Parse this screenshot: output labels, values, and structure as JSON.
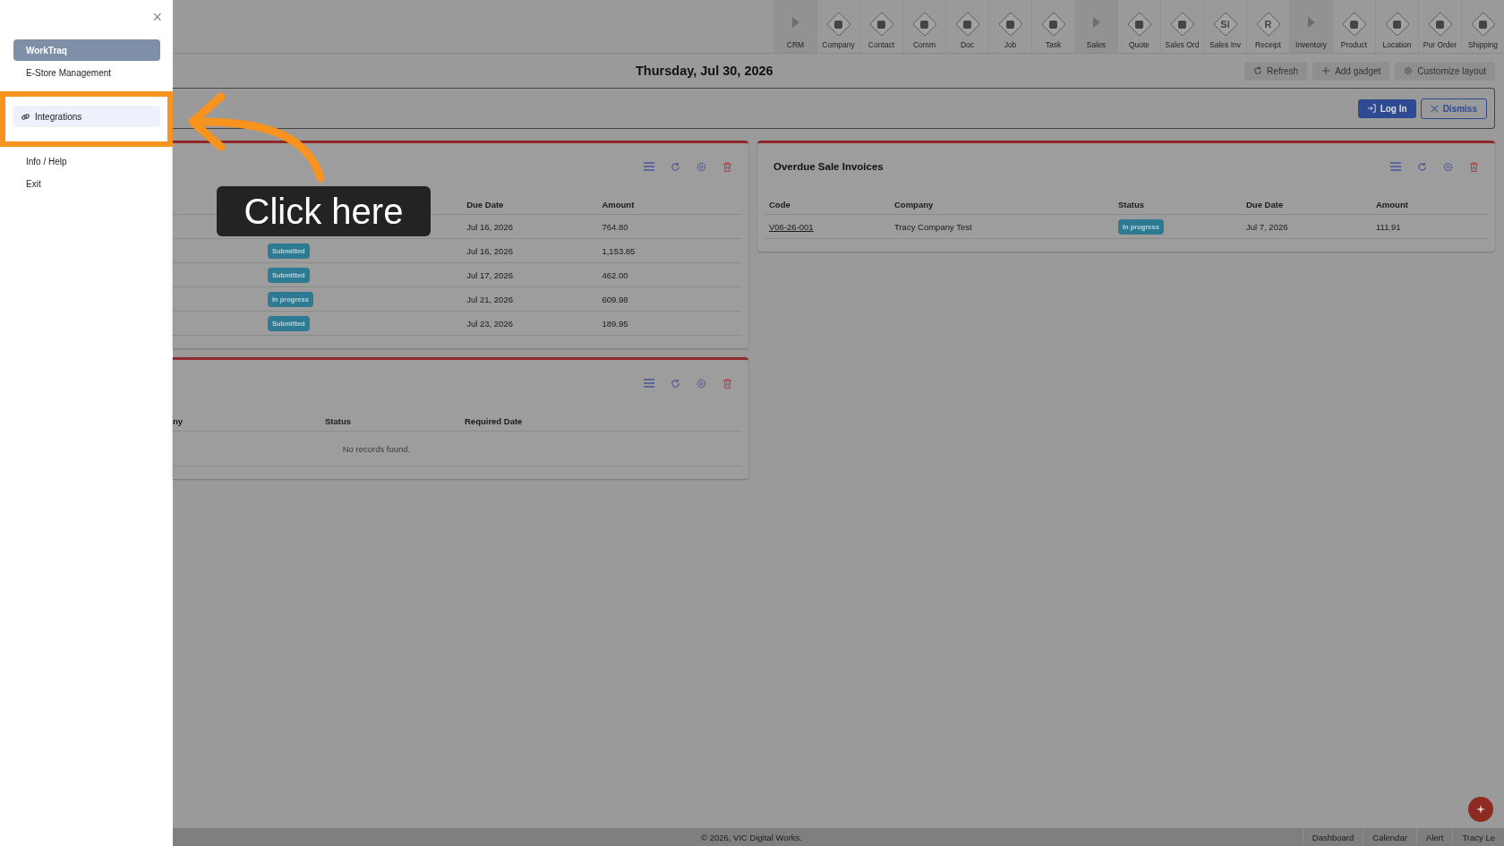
{
  "sidebar": {
    "close": "×",
    "items": [
      {
        "label": "WorkTraq",
        "kind": "plain",
        "selected": true,
        "hovered": false
      },
      {
        "label": "E-Store Management",
        "kind": "plain",
        "selected": false,
        "hovered": false
      },
      {
        "label": "Integrations",
        "kind": "link",
        "selected": false,
        "hovered": true
      },
      {
        "label": "Info / Help",
        "kind": "plain",
        "selected": false,
        "hovered": false
      },
      {
        "label": "Exit",
        "kind": "plain",
        "selected": false,
        "hovered": false
      }
    ]
  },
  "toolbar": [
    {
      "label": "CRM",
      "kind": "group"
    },
    {
      "label": "Company",
      "kind": "module"
    },
    {
      "label": "Contact",
      "kind": "module"
    },
    {
      "label": "Comm",
      "kind": "module"
    },
    {
      "label": "Doc",
      "kind": "module"
    },
    {
      "label": "Job",
      "kind": "module"
    },
    {
      "label": "Task",
      "kind": "module"
    },
    {
      "label": "Sales",
      "kind": "group"
    },
    {
      "label": "Quote",
      "kind": "module"
    },
    {
      "label": "Sales Ord",
      "kind": "module"
    },
    {
      "label": "Sales Inv",
      "kind": "module",
      "glyph": "Si"
    },
    {
      "label": "Receipt",
      "kind": "module",
      "glyph": "R"
    },
    {
      "label": "Inventory",
      "kind": "group"
    },
    {
      "label": "Product",
      "kind": "module"
    },
    {
      "label": "Location",
      "kind": "module"
    },
    {
      "label": "Pur Order",
      "kind": "module"
    },
    {
      "label": "Shipping",
      "kind": "module"
    }
  ],
  "date": "Thursday, Jul 30, 2026",
  "header_buttons": [
    "Refresh",
    "Add gadget",
    "Customize layout"
  ],
  "banner": {
    "buttons": [
      "Log In",
      "Dismiss"
    ]
  },
  "left_card": {
    "columns": [
      "Due Date",
      "Amount"
    ],
    "rows": [
      {
        "due_date": "Jul 16, 2026",
        "amount": "764.80"
      },
      {
        "status": "Submitted",
        "due_date": "Jul 16, 2026",
        "amount": "1,153.85"
      },
      {
        "status": "Submitted",
        "due_date": "Jul 17, 2026",
        "amount": "462.00"
      },
      {
        "status": "In progress",
        "due_date": "Jul 21, 2026",
        "amount": "609.98"
      },
      {
        "status": "Submitted",
        "due_date": "Jul 23, 2026",
        "amount": "189.95"
      }
    ]
  },
  "right_card": {
    "title": "Overdue Sale Invoices",
    "columns": [
      "Code",
      "Company",
      "Status",
      "Due Date",
      "Amount"
    ],
    "rows": [
      {
        "code": "V06-26-001",
        "company": "Tracy Company Test",
        "status": "In progress",
        "due_date": "Jul 7, 2026",
        "amount": "111.91"
      }
    ]
  },
  "bottom_card": {
    "columns": [
      "ny",
      "Status",
      "Required Date"
    ],
    "empty": "No records found."
  },
  "footer": {
    "copyright": "© 2026, VIC Digital Works.",
    "links": [
      "Dashboard",
      "Calendar",
      "Alert",
      "Tracy Le"
    ]
  },
  "callout": "Click here"
}
